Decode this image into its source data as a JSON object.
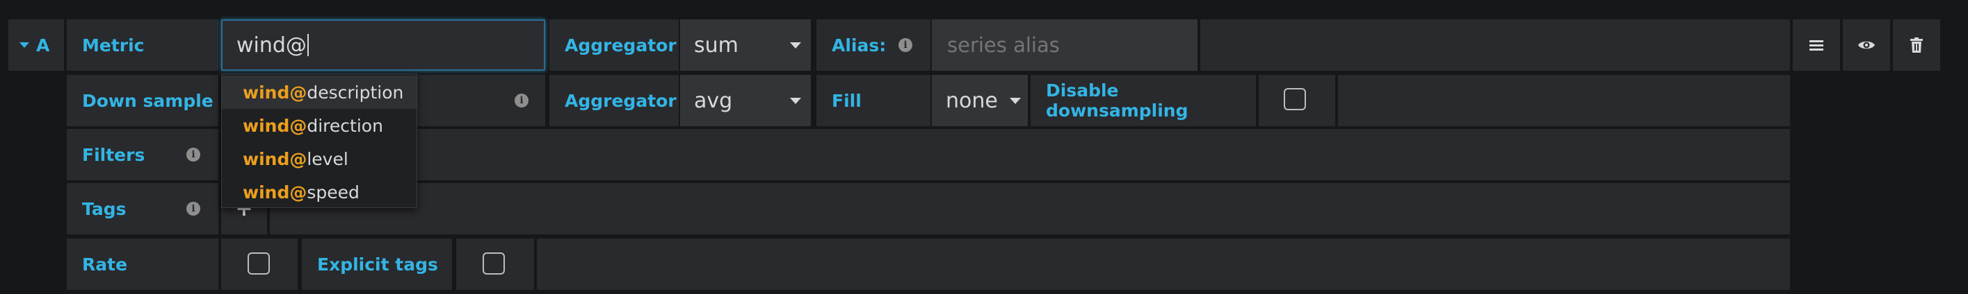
{
  "query": {
    "ref_id": "A",
    "metric": {
      "label": "Metric",
      "value": "wind@"
    },
    "aggregator": {
      "label": "Aggregator",
      "value": "sum"
    },
    "alias": {
      "label": "Alias:",
      "placeholder": "series alias",
      "value": ""
    },
    "downsample": {
      "label": "Down sample",
      "aggregator_label": "Aggregator",
      "aggregator_value": "avg",
      "fill_label": "Fill",
      "fill_value": "none",
      "disable_label": "Disable downsampling",
      "disable_checked": false
    },
    "filters": {
      "label": "Filters"
    },
    "tags": {
      "label": "Tags",
      "add_symbol": "+"
    },
    "rate": {
      "label": "Rate",
      "checked": false
    },
    "explicit_tags": {
      "label": "Explicit tags",
      "checked": false
    }
  },
  "suggestions": {
    "match": "wind@",
    "items": [
      {
        "match": "wind@",
        "rest": "description"
      },
      {
        "match": "wind@",
        "rest": "direction"
      },
      {
        "match": "wind@",
        "rest": "level"
      },
      {
        "match": "wind@",
        "rest": "speed"
      }
    ]
  },
  "icons": {
    "collapse": "caret-down-icon",
    "menu": "hamburger-menu-icon",
    "toggle": "eye-icon",
    "remove": "trash-icon",
    "info": "info-icon"
  },
  "colors": {
    "label": "#33b5e5",
    "highlight": "#eb9f1e",
    "background": "#161719",
    "panel": "#292a2d"
  }
}
